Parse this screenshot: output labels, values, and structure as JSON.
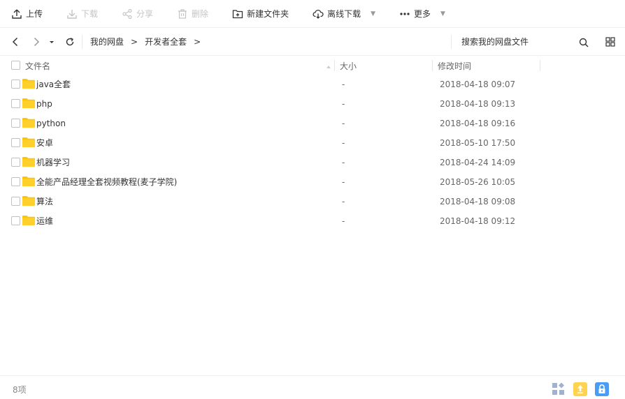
{
  "toolbar": {
    "upload": "上传",
    "download": "下载",
    "share": "分享",
    "delete": "删除",
    "new_folder": "新建文件夹",
    "offline_download": "离线下载",
    "more": "更多"
  },
  "breadcrumb": {
    "root": "我的网盘",
    "current": "开发者全套",
    "separator": ">"
  },
  "search": {
    "placeholder": "搜索我的网盘文件"
  },
  "columns": {
    "name": "文件名",
    "size": "大小",
    "modified": "修改时间"
  },
  "files": [
    {
      "name": "java全套",
      "size": "-",
      "modified": "2018-04-18 09:07"
    },
    {
      "name": "php",
      "size": "-",
      "modified": "2018-04-18 09:13"
    },
    {
      "name": "python",
      "size": "-",
      "modified": "2018-04-18 09:16"
    },
    {
      "name": "安卓",
      "size": "-",
      "modified": "2018-05-10 17:50"
    },
    {
      "name": "机器学习",
      "size": "-",
      "modified": "2018-04-24 14:09"
    },
    {
      "name": "全能产品经理全套视频教程(麦子学院)",
      "size": "-",
      "modified": "2018-05-26 10:05"
    },
    {
      "name": "算法",
      "size": "-",
      "modified": "2018-04-18 09:08"
    },
    {
      "name": "运维",
      "size": "-",
      "modified": "2018-04-18 09:12"
    }
  ],
  "footer": {
    "count": "8项"
  },
  "colors": {
    "folder": "#ffc402",
    "folder_tab": "#ffb400",
    "upload_badge": "#ffd34f",
    "lock_badge": "#4b9cf5",
    "grid_badge": "#9fb3d1"
  }
}
